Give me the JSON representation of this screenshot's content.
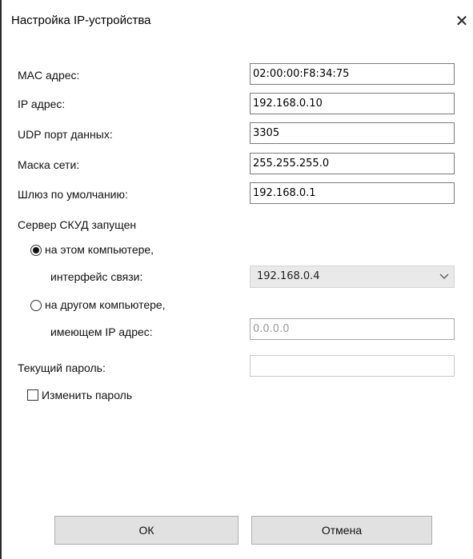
{
  "window": {
    "title": "Настройка IP-устройства",
    "close_glyph": "✕"
  },
  "fields": {
    "mac": {
      "label": "MAC адрес:",
      "value": "02:00:00:F8:34:75"
    },
    "ip": {
      "label": "IP адрес:",
      "value": "192.168.0.10"
    },
    "udp": {
      "label": "UDP порт данных:",
      "value": "3305"
    },
    "mask": {
      "label": "Маска сети:",
      "value": "255.255.255.0"
    },
    "gateway": {
      "label": "Шлюз по умолчанию:",
      "value": "192.168.0.1"
    }
  },
  "server": {
    "heading": "Сервер СКУД запущен",
    "option_this": {
      "line1": "на этом компьютере,",
      "line2": "интерфейс связи:",
      "selected": true
    },
    "interface_select": {
      "value": "192.168.0.4"
    },
    "option_other": {
      "line1": "на другом компьютере,",
      "line2": "имеющем IP адрес:",
      "selected": false
    },
    "other_ip": {
      "value": "0.0.0.0"
    }
  },
  "password": {
    "label": "Текущий пароль:",
    "value": "",
    "change_label": "Изменить пароль",
    "change_checked": false
  },
  "buttons": {
    "ok": "ОК",
    "cancel": "Отмена"
  }
}
